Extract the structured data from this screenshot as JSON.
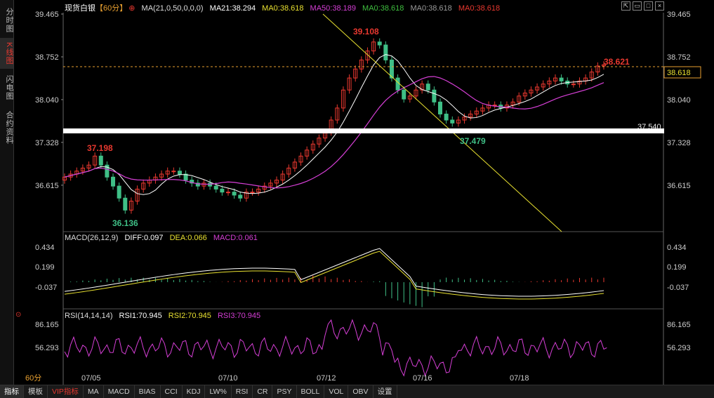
{
  "sidebar": {
    "tabs": [
      {
        "label": "分时图"
      },
      {
        "label": "K线图"
      },
      {
        "label": "闪电图"
      },
      {
        "label": "合约资料"
      }
    ]
  },
  "header": {
    "symbol": "现货白银",
    "period": "【60分】",
    "ma_param": "MA(21,0,50,0,0,0)",
    "ma21": "MA21:38.294",
    "ma0a": "MA0:38.618",
    "ma50": "MA50:38.189",
    "ma0b": "MA0:38.618",
    "ma0c": "MA0:38.618",
    "ma0d": "MA0:38.618",
    "win_icons": [
      "resize-icon",
      "restore-icon",
      "maximize-icon",
      "close-icon"
    ]
  },
  "price_axis": {
    "labels": [
      "39.465",
      "38.752",
      "38.040",
      "37.328",
      "36.615"
    ],
    "right_labels": [
      "39.465",
      "38.752",
      "38.040",
      "37.328",
      "36.615"
    ],
    "current": "38.618"
  },
  "annotations": {
    "high": "39.108",
    "low1": "36.136",
    "peak1": "37.198",
    "low2": "37.479",
    "last": "38.621",
    "support": "37.540"
  },
  "macd": {
    "title": "MACD(26,12,9)",
    "diff": "DIFF:0.097",
    "dea": "DEA:0.066",
    "macd": "MACD:0.061",
    "labels": [
      "0.434",
      "0.199",
      "-0.037"
    ]
  },
  "rsi": {
    "title": "RSI(14,14,14)",
    "rsi1": "RSI1:70.945",
    "rsi2": "RSI2:70.945",
    "rsi3": "RSI3:70.945",
    "labels": [
      "86.165",
      "56.293"
    ]
  },
  "dates": [
    "07/05",
    "07/10",
    "07/12",
    "07/16",
    "07/18"
  ],
  "period_label": "60分",
  "bottom": {
    "items": [
      "指标",
      "模板",
      "VIP指标",
      "MA",
      "MACD",
      "BIAS",
      "CCI",
      "KDJ",
      "LW%",
      "RSI",
      "CR",
      "PSY",
      "BOLL",
      "VOL",
      "OBV",
      "设置"
    ]
  },
  "colors": {
    "up": "#e8382f",
    "down": "#3fbf86",
    "ma_white": "#ffffff",
    "ma_magenta": "#d63fd6",
    "yellow": "#e8e030"
  },
  "chart_data": {
    "type": "candlestick",
    "series_closes": [
      36.75,
      36.8,
      36.85,
      36.9,
      36.95,
      37.1,
      36.95,
      36.75,
      36.6,
      36.4,
      36.2,
      36.35,
      36.55,
      36.65,
      36.7,
      36.75,
      36.8,
      36.85,
      36.85,
      36.8,
      36.7,
      36.65,
      36.6,
      36.65,
      36.6,
      36.55,
      36.5,
      36.5,
      36.45,
      36.4,
      36.5,
      36.5,
      36.55,
      36.6,
      36.65,
      36.7,
      36.8,
      36.9,
      37.0,
      37.1,
      37.2,
      37.3,
      37.4,
      37.5,
      37.7,
      37.9,
      38.2,
      38.4,
      38.55,
      38.7,
      38.85,
      39.0,
      38.95,
      38.7,
      38.4,
      38.2,
      38.05,
      38.1,
      38.2,
      38.3,
      38.2,
      38.0,
      37.8,
      37.7,
      37.65,
      37.7,
      37.75,
      37.8,
      37.85,
      37.9,
      37.95,
      37.95,
      37.9,
      37.95,
      38.0,
      38.1,
      38.15,
      38.2,
      38.25,
      38.3,
      38.35,
      38.4,
      38.35,
      38.3,
      38.3,
      38.35,
      38.4,
      38.5,
      38.6,
      38.62
    ]
  }
}
